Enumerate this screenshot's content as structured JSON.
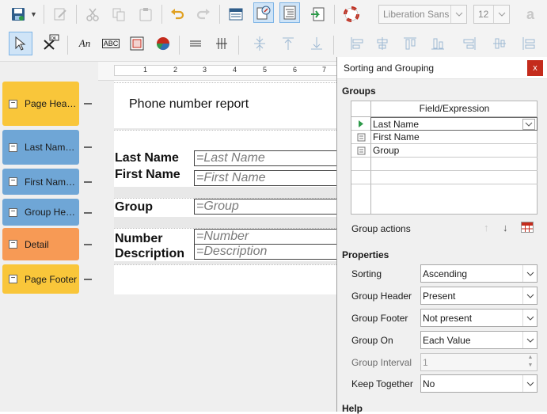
{
  "toolbar": {
    "font_name": "Liberation Sans",
    "font_size": "12",
    "label_tool": "An",
    "textfield_tool": "ABC",
    "ruler_numbers": [
      "1",
      "2",
      "3",
      "4",
      "5",
      "6",
      "7"
    ]
  },
  "sections": [
    {
      "label": "Page Header",
      "color": "#f9c63a"
    },
    {
      "label": "Last Name ...",
      "color": "#6fa6d6"
    },
    {
      "label": "First Name ...",
      "color": "#6fa6d6"
    },
    {
      "label": "Group Hea...",
      "color": "#6fa6d6"
    },
    {
      "label": "Detail",
      "color": "#f79a55"
    },
    {
      "label": "Page Footer",
      "color": "#f9c63a"
    }
  ],
  "report": {
    "title": "Phone number report",
    "last_name_label": "Last Name",
    "last_name_field": "=Last Name",
    "first_name_label": "First Name",
    "first_name_field": "=First Name",
    "group_label": "Group",
    "group_field": "=Group",
    "number_label": "Number",
    "number_field": "=Number",
    "description_label": "Description",
    "description_field": "=Description"
  },
  "dialog": {
    "title": "Sorting and Grouping",
    "close": "x",
    "groups_heading": "Groups",
    "column_header": "Field/Expression",
    "groups": [
      "Last Name",
      "First Name",
      "Group"
    ],
    "group_actions_label": "Group actions",
    "properties_heading": "Properties",
    "properties": {
      "sorting": {
        "label": "Sorting",
        "value": "Ascending"
      },
      "group_header": {
        "label": "Group Header",
        "value": "Present"
      },
      "group_footer": {
        "label": "Group Footer",
        "value": "Not present"
      },
      "group_on": {
        "label": "Group On",
        "value": "Each Value"
      },
      "group_interval": {
        "label": "Group Interval",
        "value": "1"
      },
      "keep_together": {
        "label": "Keep Together",
        "value": "No"
      }
    },
    "help_heading": "Help"
  }
}
